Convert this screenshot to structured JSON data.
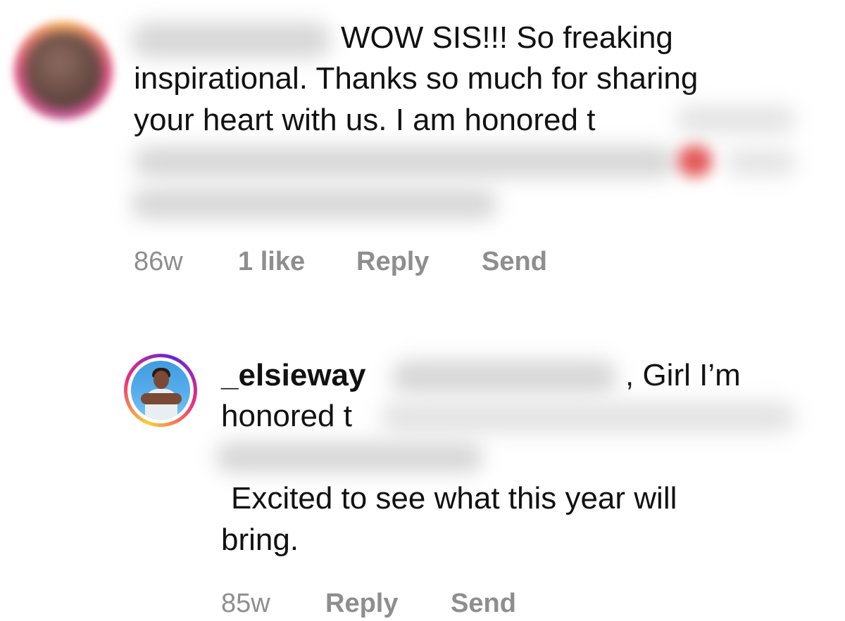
{
  "comments": [
    {
      "avatar_icon": "blurred-profile-avatar",
      "text_lines": [
        "WOW SIS!!! So freaking",
        "inspirational. Thanks so much for sharing",
        "your heart with us. I am honored t"
      ],
      "meta": {
        "age": "86w",
        "likes": "1 like",
        "reply_label": "Reply",
        "send_label": "Send"
      }
    },
    {
      "avatar_icon": "profile-avatar-with-story-ring",
      "username": "_elsieway",
      "text_lines": [
        ", Girl I’m",
        "honored t",
        "Excited to see what this year will",
        "bring."
      ],
      "meta": {
        "age": "85w",
        "reply_label": "Reply",
        "send_label": "Send"
      }
    }
  ],
  "colors": {
    "text": "#111111",
    "meta": "#8e8e8e",
    "story_ring": [
      "#f9ce34",
      "#ee2a7b",
      "#6228d7"
    ]
  }
}
